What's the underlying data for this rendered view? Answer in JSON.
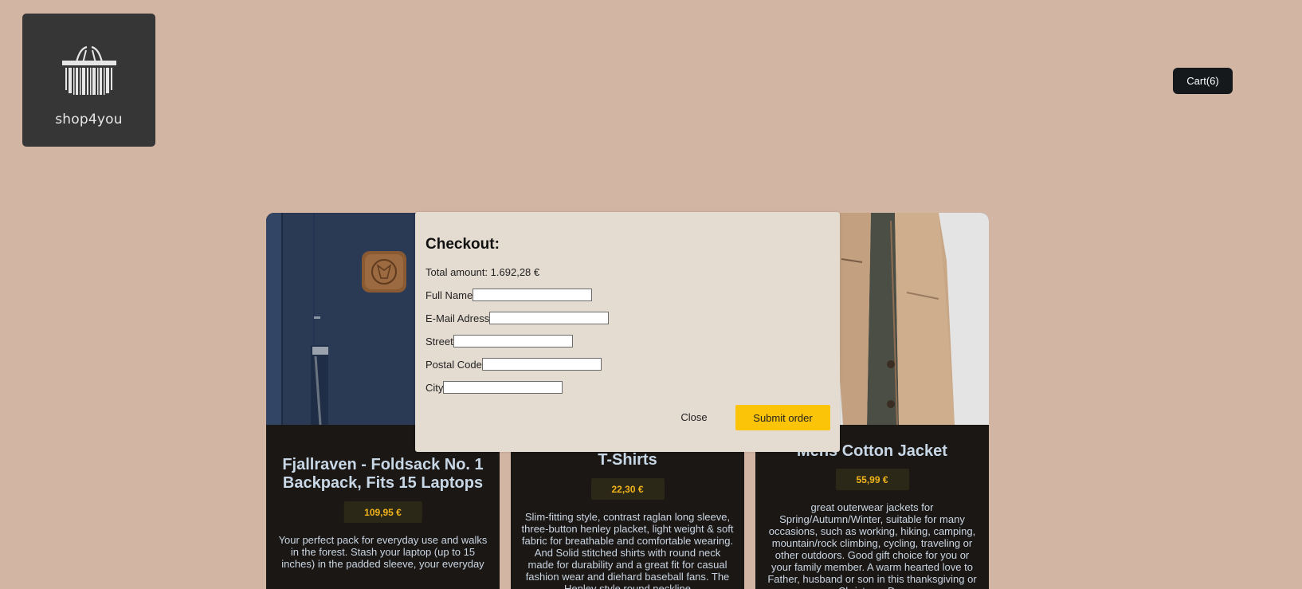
{
  "brand": {
    "name": "shop4you"
  },
  "header": {
    "cart_label": "Cart(6)"
  },
  "products": [
    {
      "title": "Fjallraven - Foldsack No. 1 Backpack, Fits 15 Laptops",
      "price": "109,95 €",
      "description": "Your perfect pack for everyday use and walks in the forest. Stash your laptop (up to 15 inches) in the padded sleeve, your everyday"
    },
    {
      "title": "T-Shirts",
      "price": "22,30 €",
      "description": "Slim-fitting style, contrast raglan long sleeve, three-button henley placket, light weight & soft fabric for breathable and comfortable wearing. And Solid stitched shirts with round neck made for durability and a great fit for casual fashion wear and diehard baseball fans. The Henley style round neckline"
    },
    {
      "title": "Mens Cotton Jacket",
      "price": "55,99 €",
      "description": "great outerwear jackets for Spring/Autumn/Winter, suitable for many occasions, such as working, hiking, camping, mountain/rock climbing, cycling, traveling or other outdoors. Good gift choice for you or your family member. A warm hearted love to Father, husband or son in this thanksgiving or Christmas Day"
    }
  ],
  "checkout": {
    "title": "Checkout:",
    "total_label": "Total amount:",
    "total_value": "1.692,28 €",
    "fields": [
      {
        "label": "Full Name",
        "value": ""
      },
      {
        "label": "E-Mail Adress",
        "value": ""
      },
      {
        "label": "Street",
        "value": ""
      },
      {
        "label": "Postal Code",
        "value": ""
      },
      {
        "label": "City",
        "value": ""
      }
    ],
    "close_label": "Close",
    "submit_label": "Submit order"
  },
  "colors": {
    "page_background": "#d3b5a3",
    "modal_background": "#e4dbd1",
    "accent": "#fbc408",
    "price_text": "#f0b31b",
    "card_background": "#1b1714"
  },
  "icons": [
    "shopping-basket-barcode-icon"
  ]
}
